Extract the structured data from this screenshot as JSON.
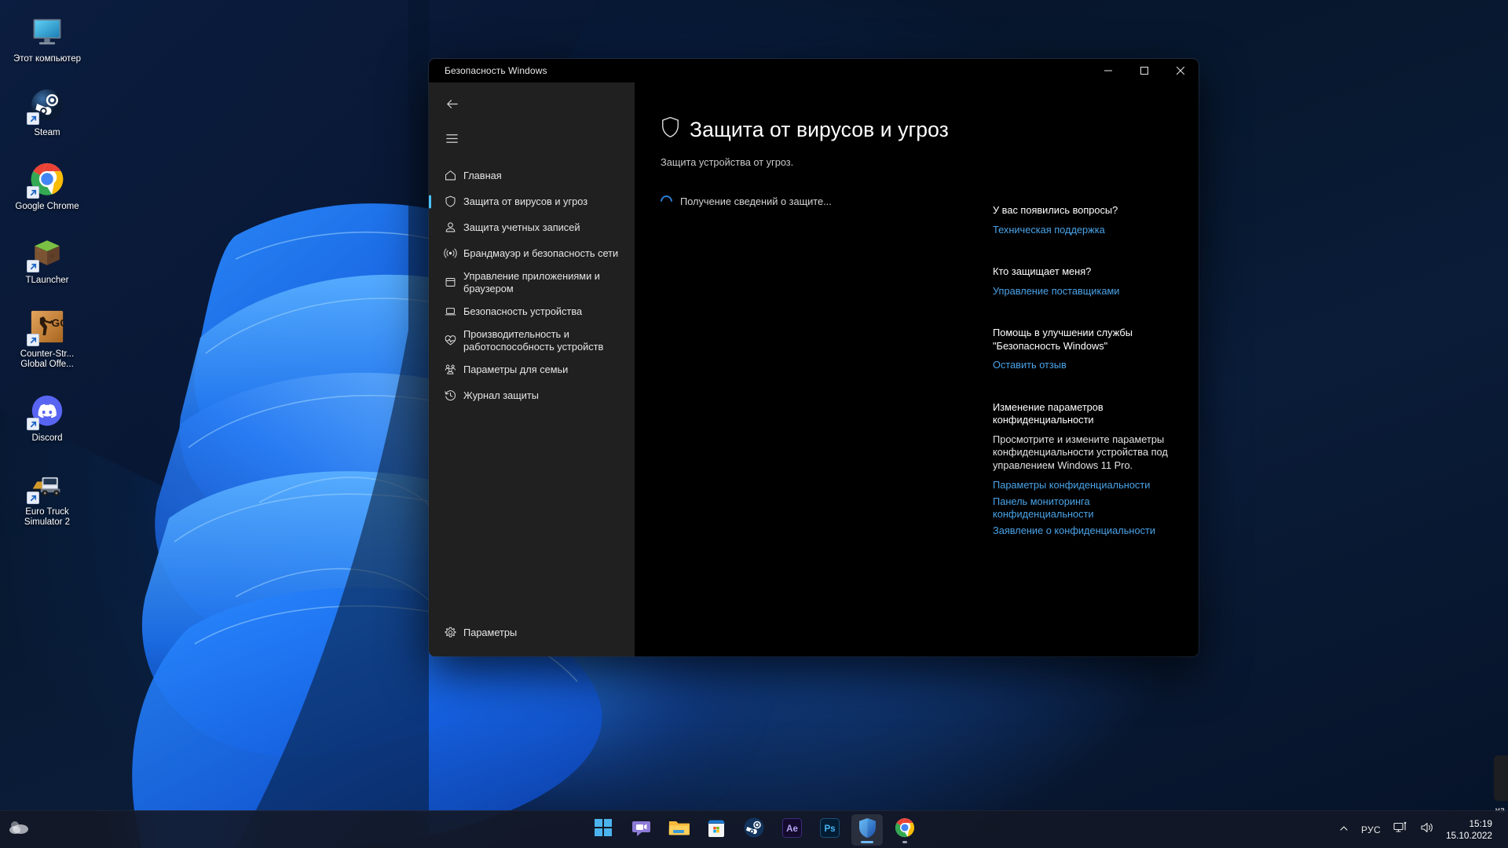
{
  "desktop": {
    "icons": [
      {
        "label": "Этот компьютер",
        "icon": "this-pc-icon",
        "shortcut": false
      },
      {
        "label": "Steam",
        "icon": "steam-icon",
        "shortcut": true
      },
      {
        "label": "Google Chrome",
        "icon": "chrome-icon",
        "shortcut": true
      },
      {
        "label": "TLauncher",
        "icon": "minecraft-block-icon",
        "shortcut": true
      },
      {
        "label": "Counter-Str... Global Offe...",
        "icon": "csgo-icon",
        "shortcut": true
      },
      {
        "label": "Discord",
        "icon": "discord-icon",
        "shortcut": true
      },
      {
        "label": "Euro Truck Simulator 2",
        "icon": "truck-icon",
        "shortcut": true
      }
    ]
  },
  "window": {
    "title": "Безопасность Windows",
    "caption": {
      "minimize": "minimize-icon",
      "maximize": "maximize-icon",
      "close": "close-icon"
    }
  },
  "sidebar": {
    "back_label": "back-arrow-icon",
    "hamburger_label": "hamburger-menu-icon",
    "items": [
      {
        "label": "Главная",
        "icon": "home-icon",
        "selected": false
      },
      {
        "label": "Защита от вирусов и угроз",
        "icon": "shield-icon",
        "selected": true
      },
      {
        "label": "Защита учетных записей",
        "icon": "person-icon",
        "selected": false
      },
      {
        "label": "Брандмауэр и безопасность сети",
        "icon": "wifi-icon",
        "selected": false
      },
      {
        "label": "Управление приложениями и браузером",
        "icon": "app-window-icon",
        "selected": false
      },
      {
        "label": "Безопасность устройства",
        "icon": "laptop-icon",
        "selected": false
      },
      {
        "label": "Производительность и работоспособность устройств",
        "icon": "heartbeat-icon",
        "selected": false
      },
      {
        "label": "Параметры для семьи",
        "icon": "family-icon",
        "selected": false
      },
      {
        "label": "Журнал защиты",
        "icon": "history-icon",
        "selected": false
      }
    ],
    "settings": {
      "label": "Параметры",
      "icon": "gear-icon"
    }
  },
  "main": {
    "title": "Защита от вирусов и угроз",
    "title_icon": "shield-icon",
    "subtitle": "Защита устройства от угроз.",
    "loading_text": "Получение сведений о защите...",
    "spinner_icon": "loading-spinner-icon"
  },
  "right_rail": {
    "blocks": [
      {
        "title": "У вас появились вопросы?",
        "body": "",
        "links": [
          "Техническая поддержка"
        ]
      },
      {
        "title": "Кто защищает меня?",
        "body": "",
        "links": [
          "Управление поставщиками"
        ]
      },
      {
        "title": "Помощь в улучшении службы \"Безопасность Windows\"",
        "body": "",
        "links": [
          "Оставить отзыв"
        ]
      },
      {
        "title": "Изменение параметров конфиденциальности",
        "body": "Просмотрите и измените параметры конфиденциальности устройства под управлением Windows 11 Pro.",
        "links": [
          "Параметры конфиденциальности",
          "Панель мониторинга конфиденциальности",
          "Заявление о конфиденциальности"
        ]
      }
    ]
  },
  "peek": {
    "text": "на"
  },
  "taskbar": {
    "left_icon": "weather-icon",
    "items": [
      {
        "name": "start-button",
        "icon": "windows-logo-icon",
        "state": "none"
      },
      {
        "name": "taskbar-chat",
        "icon": "chat-icon",
        "state": "none"
      },
      {
        "name": "taskbar-explorer",
        "icon": "file-explorer-icon",
        "state": "none"
      },
      {
        "name": "taskbar-store",
        "icon": "microsoft-store-icon",
        "state": "none"
      },
      {
        "name": "taskbar-steam",
        "icon": "steam-icon",
        "state": "none"
      },
      {
        "name": "taskbar-after-effects",
        "icon": "after-effects-icon",
        "state": "none"
      },
      {
        "name": "taskbar-photoshop",
        "icon": "photoshop-icon",
        "state": "none"
      },
      {
        "name": "taskbar-windows-security",
        "icon": "shield-blue-icon",
        "state": "active"
      },
      {
        "name": "taskbar-chrome",
        "icon": "chrome-icon",
        "state": "running"
      }
    ],
    "tray": {
      "chevron": "chevron-up-icon",
      "language": "РУС",
      "network": "network-icon",
      "volume": "volume-icon"
    },
    "clock": {
      "time": "15:19",
      "date": "15.10.2022"
    }
  }
}
